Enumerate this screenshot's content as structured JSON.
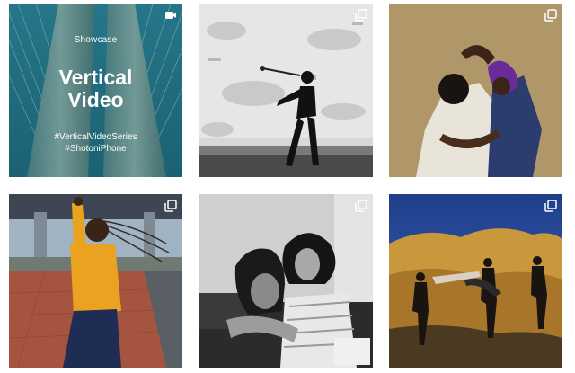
{
  "feed": {
    "posts": [
      {
        "kicker": "Showcase",
        "title_line1": "Vertical",
        "title_line2": "Video",
        "hashtag1": "#VerticalVideoSeries",
        "hashtag2": "#ShotoniPhone",
        "badge": "video-icon"
      },
      {
        "badge": "multiple-posts-icon"
      },
      {
        "badge": "multiple-posts-icon"
      },
      {
        "badge": "multiple-posts-icon"
      },
      {
        "badge": "multiple-posts-icon"
      },
      {
        "badge": "multiple-posts-icon"
      }
    ]
  },
  "colors": {
    "background": "#ffffff",
    "badge": "#ffffff"
  }
}
